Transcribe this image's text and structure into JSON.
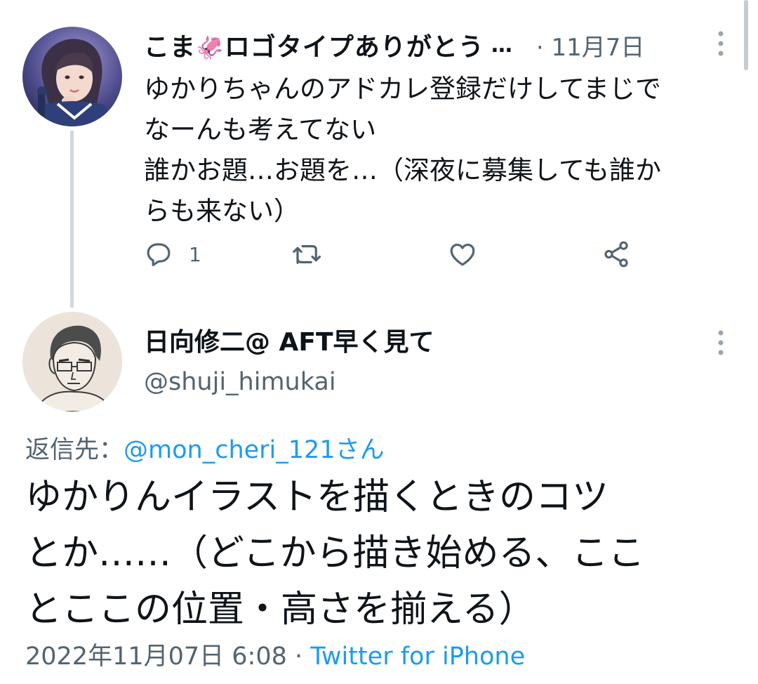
{
  "parent_tweet": {
    "display_name_prefix": "こま",
    "display_name_emoji": "🦑",
    "display_name_suffix": "ロゴタイプありがとう",
    "truncation": "…",
    "separator": "·",
    "time": "11月7日",
    "text": "ゆかりちゃんのアドカレ登録だけしてまじで\nなーんも考えてない\n誰かお題…お題を…（深夜に募集しても誰か\nらも来ない）",
    "reply_count": "1",
    "icons": {
      "reply": "reply-icon",
      "retweet": "retweet-icon",
      "like": "heart-icon",
      "share": "share-icon",
      "more": "more-vertical-icon"
    }
  },
  "focal_tweet": {
    "display_name": "日向修二@ AFT早く見て",
    "handle": "@shuji_himukai",
    "reply_label": "返信先：",
    "reply_mention": "@mon_cheri_121さん",
    "text": "ゆかりんイラストを描くときのコツ\nとか……（どこから描き始める、ここ\nとここの位置・高さを揃える）",
    "date": "2022年11月07日 6:08",
    "separator": "·",
    "source": "Twitter for iPhone"
  },
  "colors": {
    "text": "#0f1419",
    "secondary": "#536471",
    "link": "#1d9bf0",
    "thread_line": "#cfd9de"
  }
}
